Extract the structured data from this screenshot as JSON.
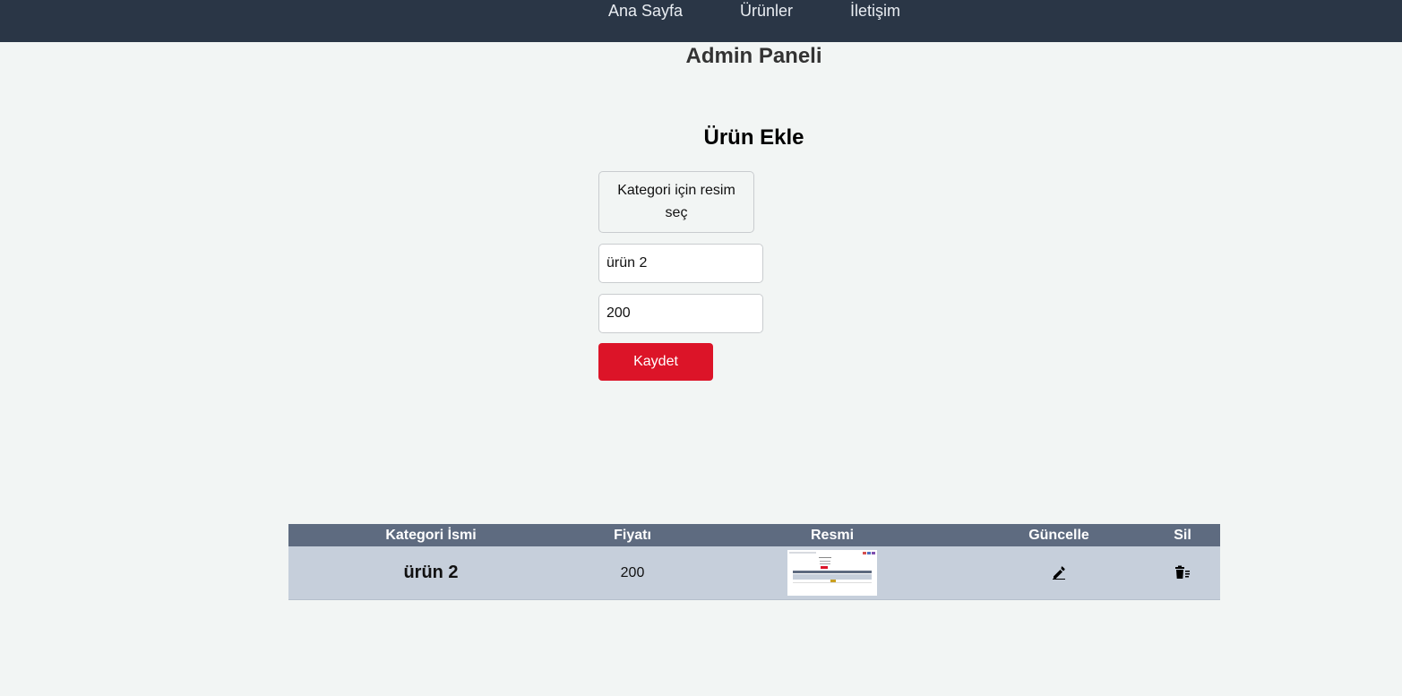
{
  "nav": {
    "links": [
      "Ana Sayfa",
      "Ürünler",
      "İletişim"
    ]
  },
  "page": {
    "title": "Admin Paneli"
  },
  "form": {
    "title": "Ürün Ekle",
    "file_button_label": "Kategori için resim seç",
    "name_value": "ürün 2",
    "price_value": "200",
    "save_label": "Kaydet"
  },
  "table": {
    "headers": [
      "Kategori İsmi",
      "Fiyatı",
      "Resmi",
      "Güncelle",
      "Sil"
    ],
    "rows": [
      {
        "name": "ürün 2",
        "price": "200",
        "image": "product-image-thumbnail",
        "edit_icon": "pencil-icon",
        "delete_icon": "trash-icon"
      }
    ]
  },
  "colors": {
    "navbar_bg": "#2a3646",
    "page_bg": "#f2f5f4",
    "accent": "#dc1428",
    "table_header_bg": "#5e6b80",
    "table_row_bg": "#c6cfdb"
  }
}
